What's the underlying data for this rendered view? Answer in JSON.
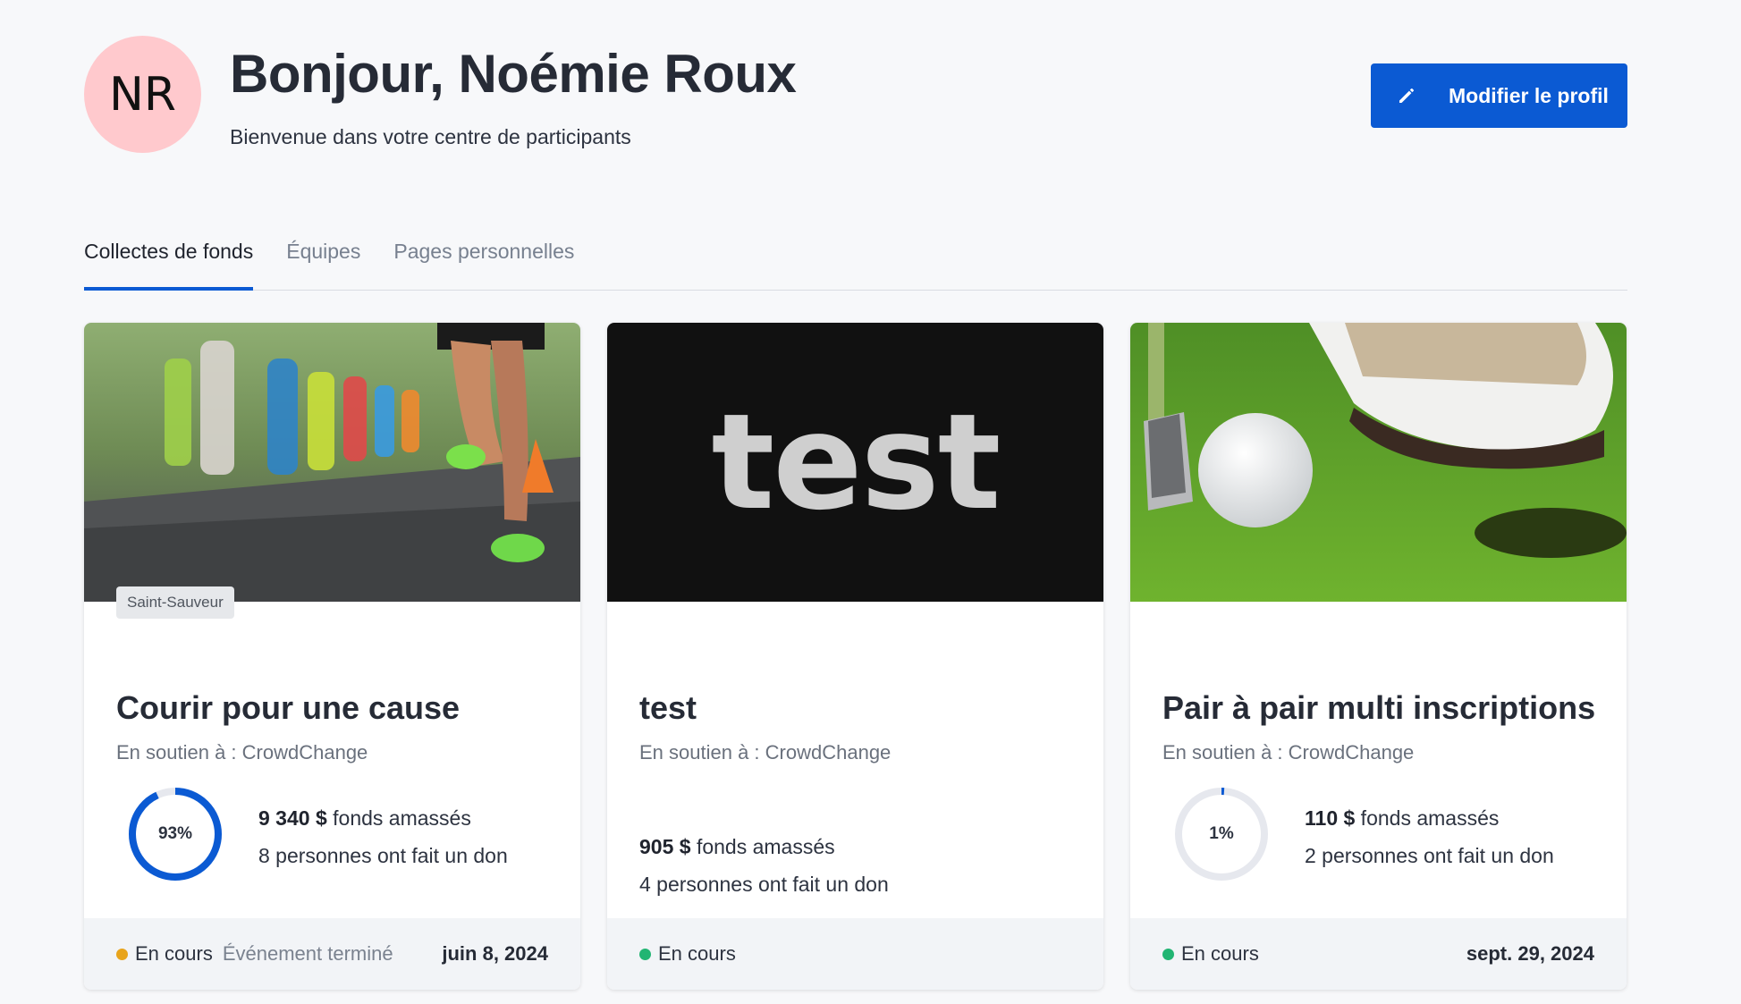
{
  "header": {
    "avatar_initials": "NR",
    "avatar_color": "#ffc9cd",
    "greeting": "Bonjour, Noémie Roux",
    "subtitle": "Bienvenue dans votre centre de participants",
    "edit_button_label": "Modifier le profil",
    "edit_button_icon": "pencil-icon",
    "accent_color": "#0b5ad3"
  },
  "tabs": [
    {
      "label": "Collectes de fonds",
      "active": true
    },
    {
      "label": "Équipes",
      "active": false
    },
    {
      "label": "Pages personnelles",
      "active": false
    }
  ],
  "cards": [
    {
      "image": "marathon-runners-photo",
      "location": "Saint-Sauveur",
      "title": "Courir pour une cause",
      "support": "En soutien à : CrowdChange",
      "progress_percent": 93,
      "progress_label": "93%",
      "amount": "9 340 $",
      "amount_suffix": " fonds amassés",
      "donors": "8 personnes ont fait un don",
      "status": "En cours",
      "status_color": "#e8a41c",
      "ended_label": "Événement terminé",
      "date": "juin 8, 2024"
    },
    {
      "image": "test-text-banner",
      "image_text": "test",
      "title": "test",
      "support": "En soutien à : CrowdChange",
      "amount": "905 $",
      "amount_suffix": " fonds amassés",
      "donors": "4 personnes ont fait un don",
      "status": "En cours",
      "status_color": "#22b573"
    },
    {
      "image": "golf-ball-photo",
      "title": "Pair à pair multi inscriptions",
      "support": "En soutien à : CrowdChange",
      "progress_percent": 1,
      "progress_label": "1%",
      "amount": "110 $",
      "amount_suffix": " fonds amassés",
      "donors": "2 personnes ont fait un don",
      "status": "En cours",
      "status_color": "#22b573",
      "date": "sept. 29, 2024"
    }
  ]
}
